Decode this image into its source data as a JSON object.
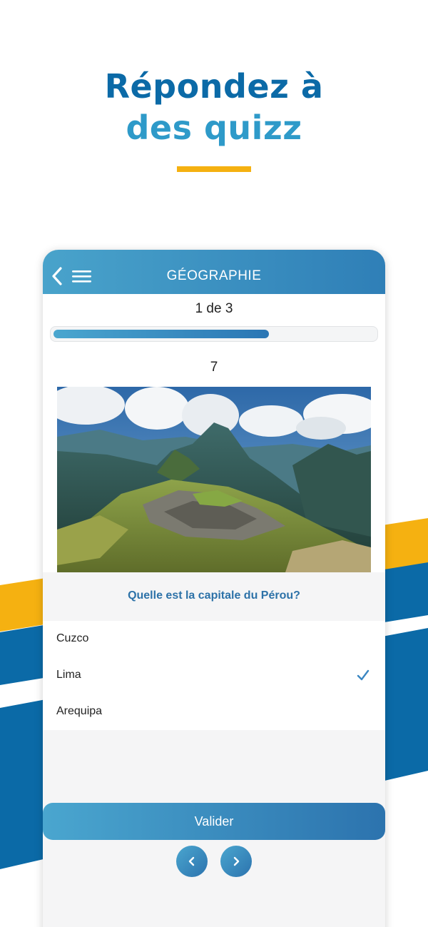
{
  "headline": {
    "line1": "Répondez à",
    "line2": "des quizz"
  },
  "colors": {
    "primary_blue": "#0b6aa7",
    "light_blue": "#2e9ac9",
    "accent_yellow": "#f5b111",
    "header_gradient_start": "#49a3cb",
    "header_gradient_end": "#2f7fb7"
  },
  "app": {
    "header": {
      "title": "GÉOGRAPHIE",
      "back_icon": "chevron-left-icon",
      "menu_icon": "hamburger-menu-icon"
    },
    "quiz": {
      "counter": "1 de 3",
      "progress": 0.67,
      "score": "7",
      "image": "machu-picchu-photo",
      "question": "Quelle est la capitale du Pérou?",
      "answers": [
        {
          "label": "Cuzco",
          "selected": false
        },
        {
          "label": "Lima",
          "selected": true
        },
        {
          "label": "Arequipa",
          "selected": false
        }
      ],
      "validate_label": "Valider",
      "prev_icon": "chevron-left-icon",
      "next_icon": "chevron-right-icon"
    }
  }
}
